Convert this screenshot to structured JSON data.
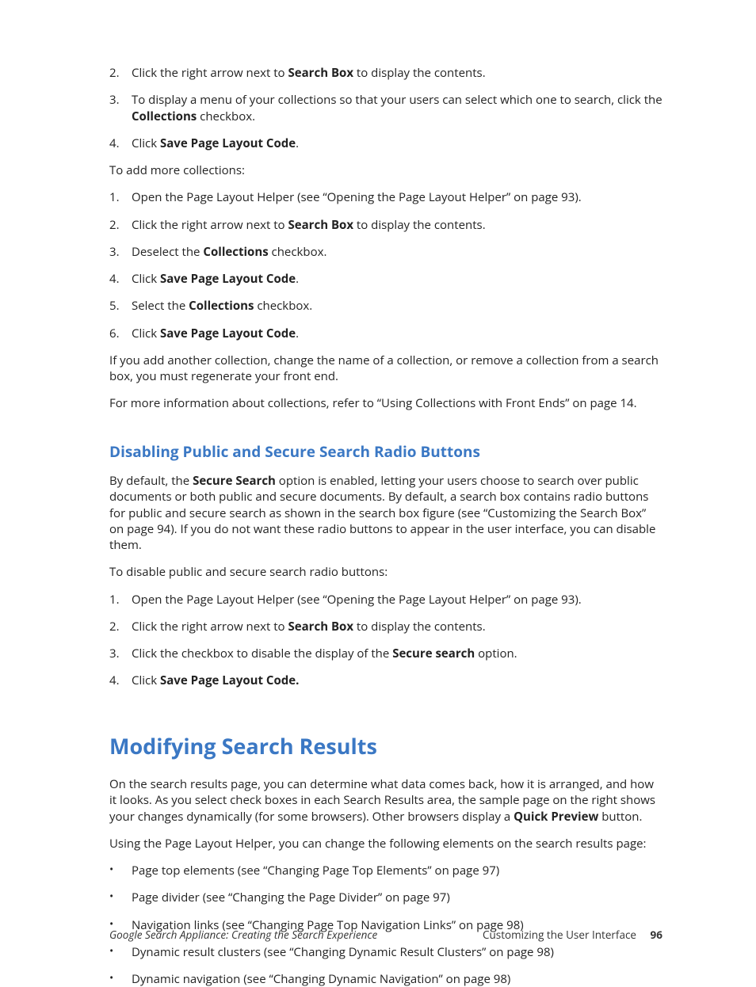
{
  "list1": {
    "i2": {
      "num": "2.",
      "pre": "Click the right arrow next to ",
      "bold": "Search Box",
      "post": " to display the contents."
    },
    "i3": {
      "num": "3.",
      "pre": "To display a menu of your collections so that your users can select which one to search, click the ",
      "bold": "Collections",
      "post": " checkbox."
    },
    "i4": {
      "num": "4.",
      "pre": "Click ",
      "bold": "Save Page Layout Code",
      "post": "."
    }
  },
  "para_add_more": "To add more collections:",
  "list2": {
    "i1": {
      "num": "1.",
      "text": "Open the Page Layout Helper (see “Opening the Page Layout Helper” on page 93)."
    },
    "i2": {
      "num": "2.",
      "pre": "Click the right arrow next to ",
      "bold": "Search Box",
      "post": " to display the contents."
    },
    "i3": {
      "num": "3.",
      "pre": "Deselect the ",
      "bold": "Collections",
      "post": " checkbox."
    },
    "i4": {
      "num": "4.",
      "pre": "Click ",
      "bold": "Save Page Layout Code",
      "post": "."
    },
    "i5": {
      "num": "5.",
      "pre": "Select the ",
      "bold": "Collections",
      "post": " checkbox."
    },
    "i6": {
      "num": "6.",
      "pre": "Click ",
      "bold": "Save Page Layout Code",
      "post": "."
    }
  },
  "para_if_add": "If you add another collection, change the name of a collection, or remove a collection from a search box, you must regenerate your front end.",
  "para_more_info": "For more information about collections, refer to “Using Collections with Front Ends” on page 14.",
  "h2_disabling": "Disabling Public and Secure Search Radio Buttons",
  "para_by_default": {
    "t1": "By default, the ",
    "b1": "Secure Search",
    "t2": " option is enabled, letting your users choose to search over public documents or both public and secure documents. By default, a search box contains radio buttons for public and secure search as shown in the search box figure (see “Customizing the Search Box” on page 94). If you do not want these radio buttons to appear in the user interface, you can disable them."
  },
  "para_to_disable": "To disable public and secure search radio buttons:",
  "list3": {
    "i1": {
      "num": "1.",
      "text": "Open the Page Layout Helper (see “Opening the Page Layout Helper” on page 93)."
    },
    "i2": {
      "num": "2.",
      "pre": "Click the right arrow next to ",
      "bold": "Search Box",
      "post": " to display the contents."
    },
    "i3": {
      "num": "3.",
      "pre": "Click the checkbox to disable the display of the ",
      "bold": "Secure search",
      "post": " option."
    },
    "i4": {
      "num": "4.",
      "pre": "Click ",
      "bold": "Save Page Layout Code."
    }
  },
  "h1_modifying": "Modifying Search Results",
  "para_on_results": {
    "t1": "On the search results page, you can determine what data comes back, how it is arranged, and how it looks. As you select check boxes in each Search Results area, the sample page on the right shows your changes dynamically (for some browsers). Other browsers display a ",
    "b1": "Quick Preview",
    "t2": " button."
  },
  "para_using_helper": "Using the Page Layout Helper, you can change the following elements on the search results page:",
  "bullets": {
    "b1": "Page top elements (see “Changing Page Top Elements” on page 97)",
    "b2": "Page divider (see “Changing the Page Divider” on page 97)",
    "b3": "Navigation links (see “Changing Page Top Navigation Links” on page 98)",
    "b4": "Dynamic result clusters (see “Changing Dynamic Result Clusters” on page 98)",
    "b5": "Dynamic navigation (see “Changing Dynamic Navigation” on page 98)"
  },
  "bullet_marker": "•",
  "footer": {
    "left": "Google Search Appliance: Creating the Search Experience",
    "right_label": "Customizing the User Interface",
    "page": "96"
  }
}
